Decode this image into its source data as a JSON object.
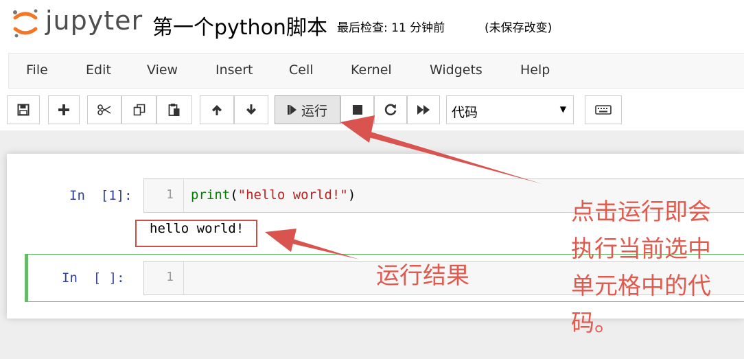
{
  "header": {
    "brand": "jupyter",
    "notebook_title": "第一个python脚本",
    "checkpoint": "最后检查: 11 分钟前",
    "autosave_status": "(未保存改变)"
  },
  "menubar": {
    "items": [
      "File",
      "Edit",
      "View",
      "Insert",
      "Cell",
      "Kernel",
      "Widgets",
      "Help"
    ]
  },
  "toolbar": {
    "run_label": "运行",
    "cell_type": "代码",
    "icons": [
      "save-icon",
      "plus-icon",
      "scissors-icon",
      "copy-icon",
      "paste-icon",
      "arrow-up-icon",
      "arrow-down-icon",
      "step-forward-icon",
      "stop-icon",
      "restart-icon",
      "fast-forward-icon",
      "keyboard-icon"
    ]
  },
  "cells": [
    {
      "prompt": "In  [1]:",
      "line_number": "1",
      "code": {
        "func": "print",
        "open": "(",
        "string": "\"hello world!\"",
        "close": ")"
      },
      "output": "hello world!"
    },
    {
      "prompt": "In  [ ]:",
      "line_number": "1"
    }
  ],
  "annotations": {
    "result": "运行结果",
    "run_lines": [
      "点击运行即会",
      "执行当前选中",
      "单元格中的代",
      "码。"
    ]
  },
  "colors": {
    "annotation": "#e05a4e",
    "prompt": "#303f9f",
    "selected_cell_border": "#66bb6a",
    "logo_orange": "#f37726"
  }
}
